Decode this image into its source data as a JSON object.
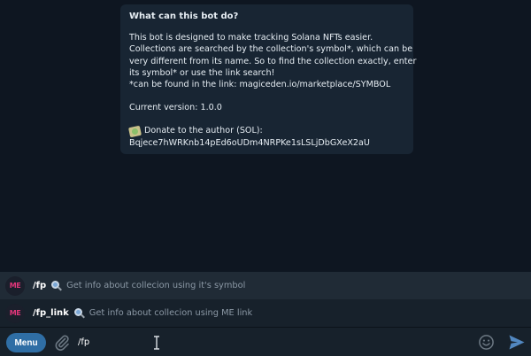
{
  "intro": {
    "title": "What can this bot do?",
    "lines": [
      "This bot is designed to make tracking Solana NFTs easier.",
      "Collections are searched by the collection's symbol*, which can be",
      "very different from its name. So to find the collection exactly, enter",
      "its symbol* or use the link search!",
      "*can be found in the link: magiceden.io/marketplace/SYMBOL"
    ],
    "version": "Current version: 1.0.0",
    "donate_label": "Donate to the author (SOL):",
    "donate_address": "Bqjece7hWRKnb14pEd6oUDm4NRPKe1sLSLjDbGXeX2aU",
    "donate_icon": "money-with-wings-icon"
  },
  "commands": [
    {
      "avatar": "ME",
      "name": "/fp",
      "icon": "magnifier-icon",
      "description": "Get info about collecion using it's symbol"
    },
    {
      "avatar": "ME",
      "name": "/fp_link",
      "icon": "magnifier-icon",
      "description": "Get info about collecion using ME link"
    }
  ],
  "composer": {
    "menu_label": "Menu",
    "input_value": "/fp",
    "attach_icon": "paperclip-icon",
    "emoji_icon": "smiley-icon",
    "send_icon": "send-icon"
  },
  "colors": {
    "background": "#0e1621",
    "card": "#182533",
    "accent": "#2f6ea5",
    "brand_me": "#e0367a"
  }
}
